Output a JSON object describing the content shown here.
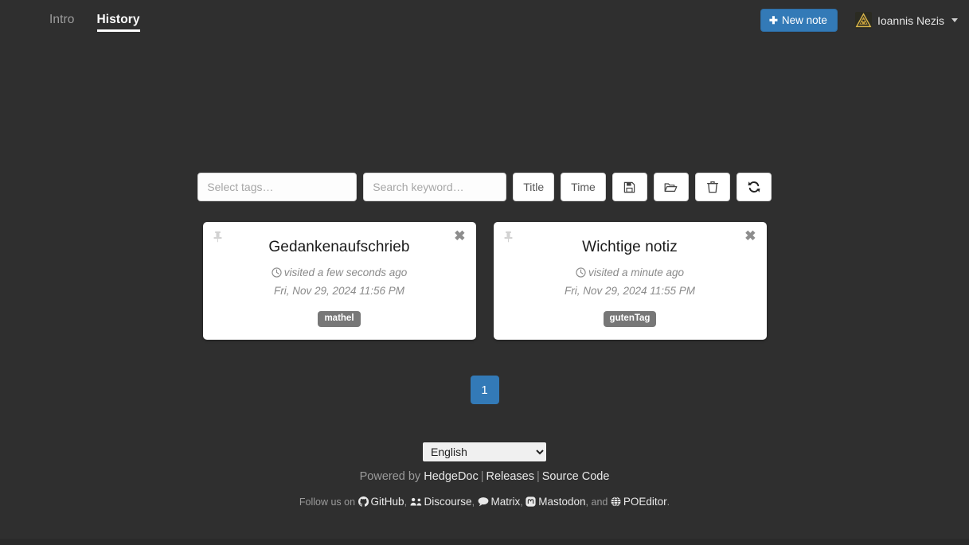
{
  "navbar": {
    "tabs": [
      {
        "label": "Intro",
        "active": false
      },
      {
        "label": "History",
        "active": true
      }
    ],
    "new_note_label": "New note",
    "new_note_color": "#337ab7",
    "user_name": "Ioannis Nezis",
    "avatar_icon": "pyramid-identicon",
    "caret_icon": "caret-down-icon"
  },
  "toolbar": {
    "tags_placeholder": "Select tags…",
    "tags_value": "",
    "search_placeholder": "Search keyword…",
    "search_value": "",
    "sort_title_label": "Title",
    "sort_time_label": "Time",
    "save_icon": "floppy-disk-icon",
    "open_icon": "folder-open-icon",
    "delete_icon": "trash-icon",
    "refresh_icon": "refresh-icon"
  },
  "notes": [
    {
      "title": "Gedankenaufschrieb",
      "visited_text": "visited a few seconds ago",
      "timestamp": "Fri, Nov 29, 2024 11:56 PM",
      "tags": [
        "mathel"
      ],
      "pin_icon": "thumbtack-icon",
      "close_icon": "close-icon",
      "clock_icon": "clock-icon"
    },
    {
      "title": "Wichtige notiz",
      "visited_text": "visited a minute ago",
      "timestamp": "Fri, Nov 29, 2024 11:55 PM",
      "tags": [
        "gutenTag"
      ],
      "pin_icon": "thumbtack-icon",
      "close_icon": "close-icon",
      "clock_icon": "clock-icon"
    }
  ],
  "pagination": {
    "pages": [
      "1"
    ],
    "current": "1",
    "active_color": "#337ab7"
  },
  "footer": {
    "language_selected": "English",
    "language_options": [
      "English"
    ],
    "powered_prefix": "Powered by",
    "powered_link": "HedgeDoc",
    "releases_link": "Releases",
    "source_link": "Source Code",
    "separator": "|",
    "follow_prefix": "Follow us on",
    "and_text": "and",
    "social": [
      {
        "label": "GitHub",
        "icon": "github-icon",
        "suffix": ","
      },
      {
        "label": "Discourse",
        "icon": "discourse-users-icon",
        "suffix": ","
      },
      {
        "label": "Matrix",
        "icon": "matrix-comment-icon",
        "suffix": ","
      },
      {
        "label": "Mastodon",
        "icon": "mastodon-icon",
        "suffix": ","
      },
      {
        "label": "POEditor",
        "icon": "poeditor-globe-icon",
        "suffix": "."
      }
    ]
  },
  "theme": {
    "background": "#2f2f2f",
    "card_background": "#ffffff",
    "accent": "#337ab7",
    "tag_background": "#777777"
  }
}
